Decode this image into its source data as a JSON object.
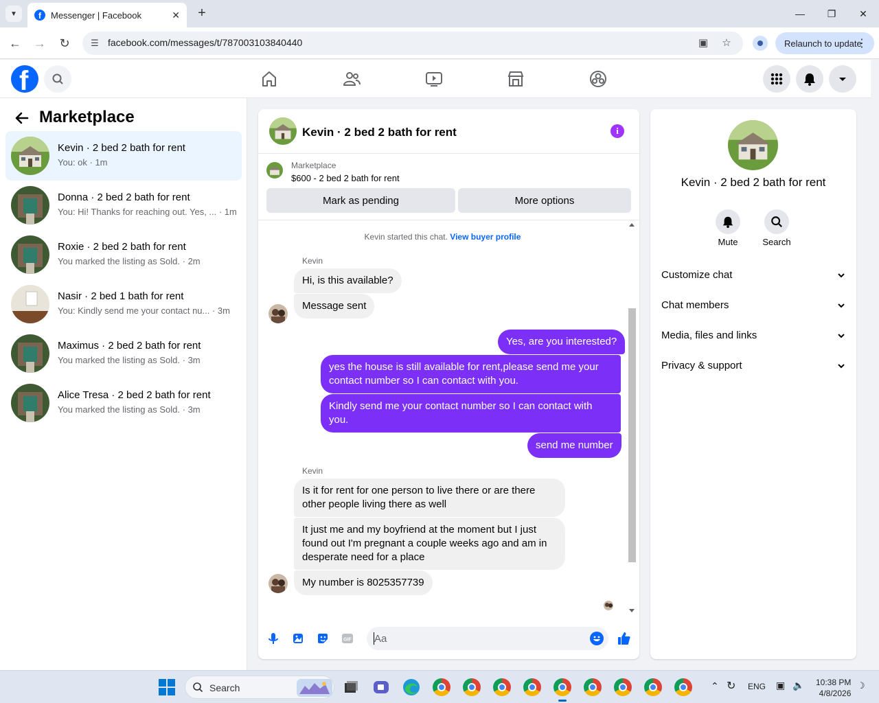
{
  "browser": {
    "tab_title": "Messenger | Facebook",
    "url": "facebook.com/messages/t/787003103840440",
    "relaunch_label": "Relaunch to update"
  },
  "sidebar": {
    "title": "Marketplace",
    "conversations": [
      {
        "name": "Kevin · 2 bed 2 bath for rent",
        "snippet": "You: ok · 1m",
        "active": true
      },
      {
        "name": "Donna · 2 bed 2 bath for rent",
        "snippet": "You: Hi! Thanks for reaching out. Yes, ...  · 1m",
        "active": false
      },
      {
        "name": "Roxie · 2 bed 2 bath for rent",
        "snippet": "You marked the listing as Sold. · 2m",
        "active": false
      },
      {
        "name": "Nasir · 2 bed 1 bath for rent",
        "snippet": "You: Kindly send me your contact nu...  · 3m",
        "active": false
      },
      {
        "name": "Maximus · 2 bed 2 bath for rent",
        "snippet": "You marked the listing as Sold. · 3m",
        "active": false
      },
      {
        "name": "Alice Tresa · 2 bed 2 bath for rent",
        "snippet": "You marked the listing as Sold. · 3m",
        "active": false
      }
    ]
  },
  "chat": {
    "title": "Kevin · 2 bed 2 bath for rent",
    "listing": {
      "source": "Marketplace",
      "price_title": "$600 - 2 bed 2 bath for rent",
      "mark_pending_label": "Mark as pending",
      "more_options_label": "More options"
    },
    "system_message": "Kevin started this chat.",
    "system_link": "View buyer profile",
    "sender_name": "Kevin",
    "messages": [
      {
        "dir": "in",
        "text": "Hi, is this available?"
      },
      {
        "dir": "in",
        "text": "Message sent"
      },
      {
        "dir": "out",
        "text": "Yes, are you interested?"
      },
      {
        "dir": "out",
        "text": "yes the house is still available for rent,please send me your contact number so I can contact with you."
      },
      {
        "dir": "out",
        "text": "Kindly send me your contact number so I can contact with you."
      },
      {
        "dir": "out",
        "text": "send me number"
      },
      {
        "dir": "in",
        "text": "Is it for rent for one person to live there or are there other people living there as well"
      },
      {
        "dir": "in",
        "text": "It just me and my boyfriend at the moment but I just found out I'm pregnant a couple weeks ago and am in desperate need for a place"
      },
      {
        "dir": "in",
        "text": "My number is 8025357739"
      }
    ],
    "composer_placeholder": "Aa"
  },
  "info_panel": {
    "name": "Kevin · 2 bed 2 bath for rent",
    "mute_label": "Mute",
    "search_label": "Search",
    "sections": [
      "Customize chat",
      "Chat members",
      "Media, files and links",
      "Privacy & support"
    ]
  },
  "taskbar": {
    "search_label": "Search",
    "language": "ENG",
    "time": "10:38 PM",
    "date": "4/8/2026"
  },
  "colors": {
    "fb_blue": "#0866ff",
    "outgoing_bubble": "#7b2ff7",
    "info_purple": "#a033ff",
    "active_conv_bg": "#ebf5ff"
  }
}
